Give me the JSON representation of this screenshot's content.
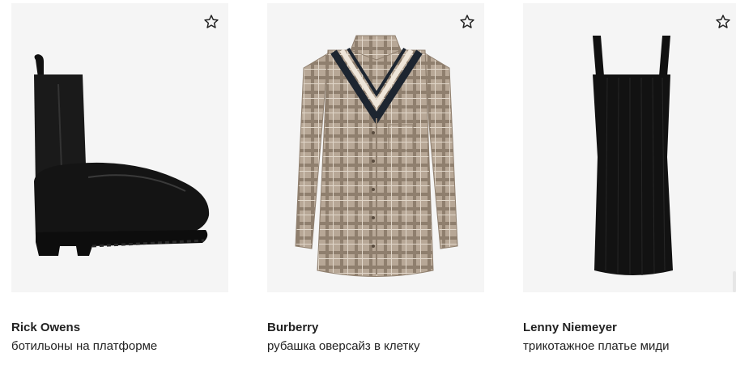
{
  "products": [
    {
      "brand": "Rick Owens",
      "description": "ботильоны на платформе",
      "favorite_icon": "star-outline-icon"
    },
    {
      "brand": "Burberry",
      "description": "рубашка оверсайз в клетку",
      "favorite_icon": "star-outline-icon"
    },
    {
      "brand": "Lenny Niemeyer",
      "description": "трикотажное платье миди",
      "favorite_icon": "star-outline-icon"
    }
  ],
  "colors": {
    "card_background": "#f5f5f5",
    "text": "#222222"
  }
}
